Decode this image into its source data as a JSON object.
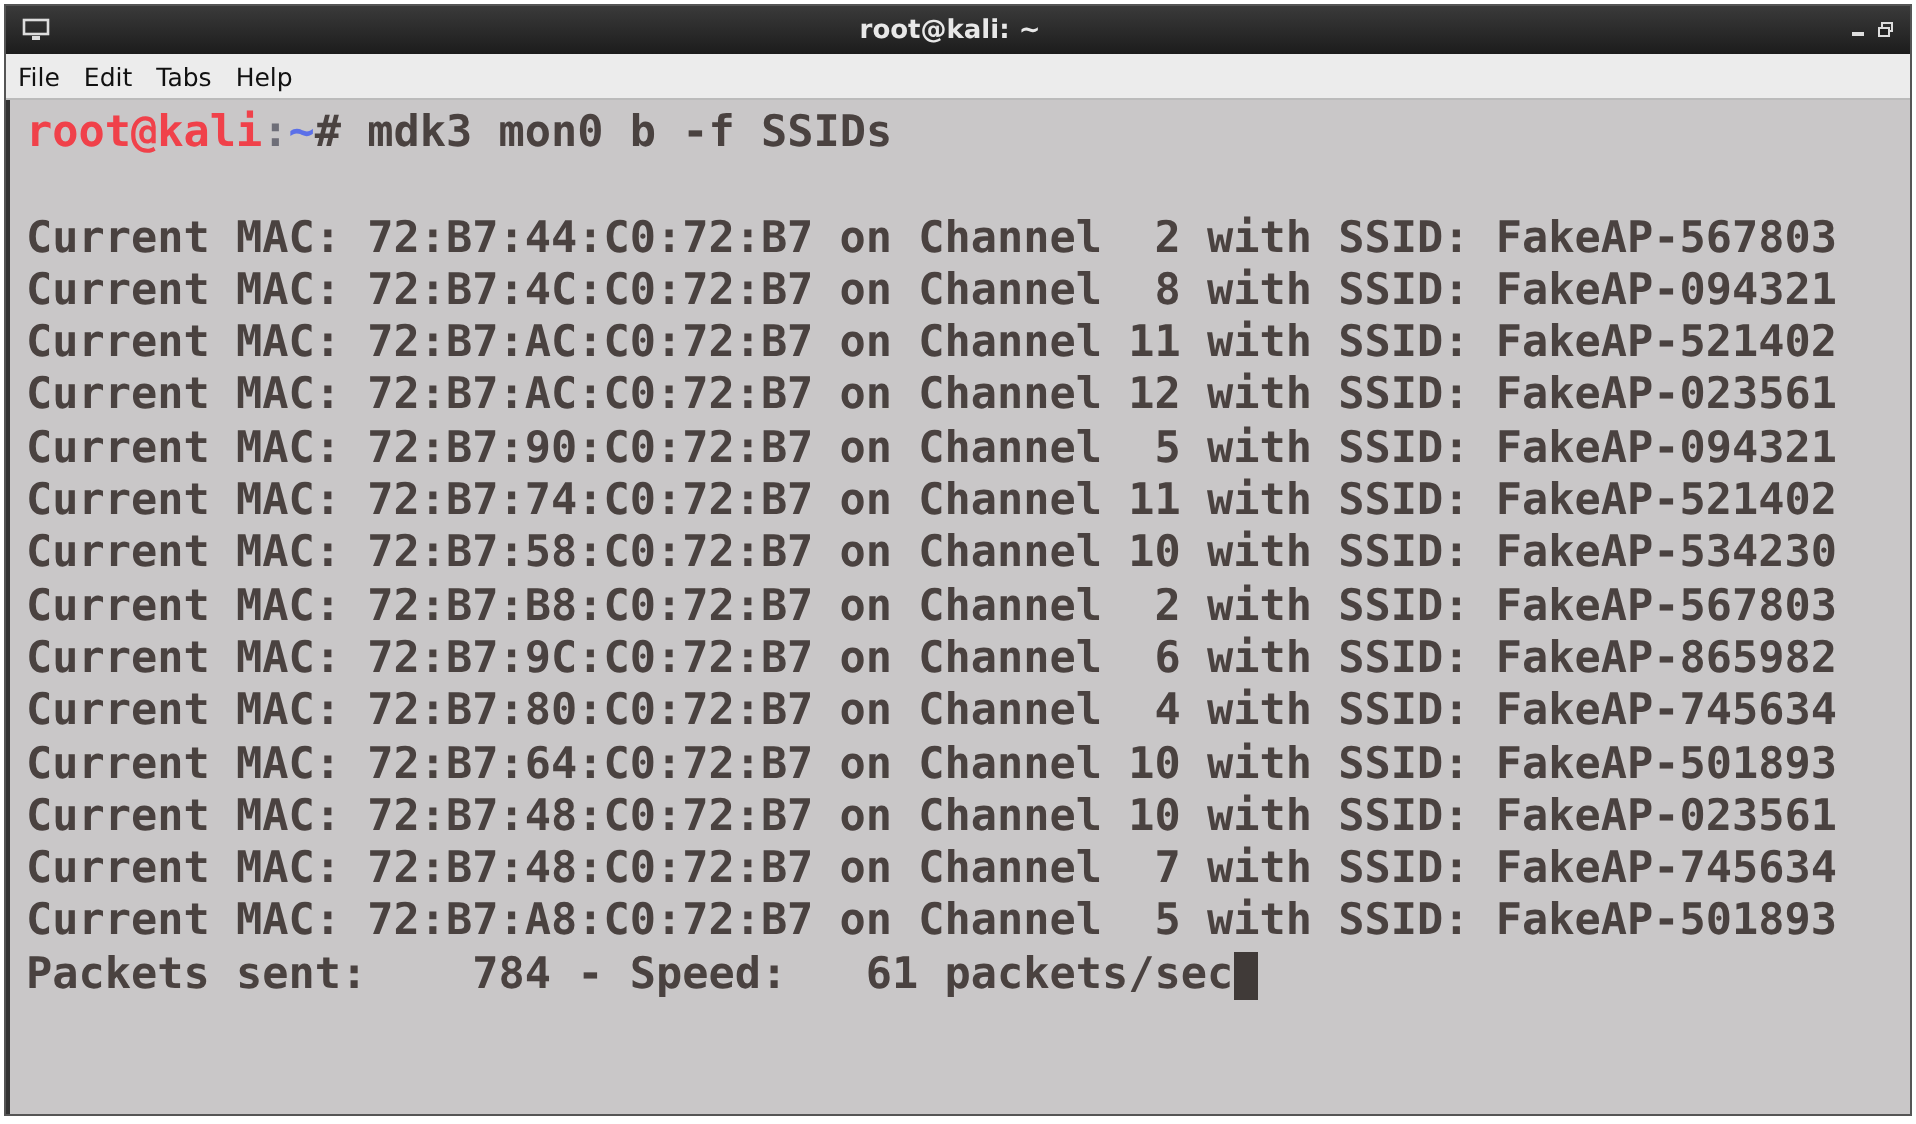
{
  "window": {
    "title": "root@kali: ~"
  },
  "menu": [
    "File",
    "Edit",
    "Tabs",
    "Help"
  ],
  "terminal": {
    "prompt": {
      "user": "root@kali",
      "separator": ":",
      "path": "~",
      "symbol": "#",
      "command": " mdk3 mon0 b -f SSIDs"
    },
    "lines": [
      "Current MAC: 72:B7:44:C0:72:B7 on Channel  2 with SSID: FakeAP-567803",
      "Current MAC: 72:B7:4C:C0:72:B7 on Channel  8 with SSID: FakeAP-094321",
      "Current MAC: 72:B7:AC:C0:72:B7 on Channel 11 with SSID: FakeAP-521402",
      "Current MAC: 72:B7:AC:C0:72:B7 on Channel 12 with SSID: FakeAP-023561",
      "Current MAC: 72:B7:90:C0:72:B7 on Channel  5 with SSID: FakeAP-094321",
      "Current MAC: 72:B7:74:C0:72:B7 on Channel 11 with SSID: FakeAP-521402",
      "Current MAC: 72:B7:58:C0:72:B7 on Channel 10 with SSID: FakeAP-534230",
      "Current MAC: 72:B7:B8:C0:72:B7 on Channel  2 with SSID: FakeAP-567803",
      "Current MAC: 72:B7:9C:C0:72:B7 on Channel  6 with SSID: FakeAP-865982",
      "Current MAC: 72:B7:80:C0:72:B7 on Channel  4 with SSID: FakeAP-745634",
      "Current MAC: 72:B7:64:C0:72:B7 on Channel 10 with SSID: FakeAP-501893",
      "Current MAC: 72:B7:48:C0:72:B7 on Channel 10 with SSID: FakeAP-023561",
      "Current MAC: 72:B7:48:C0:72:B7 on Channel  7 with SSID: FakeAP-745634",
      "Current MAC: 72:B7:A8:C0:72:B7 on Channel  5 with SSID: FakeAP-501893"
    ],
    "status_line": "Packets sent:    784 - Speed:   61 packets/sec"
  }
}
